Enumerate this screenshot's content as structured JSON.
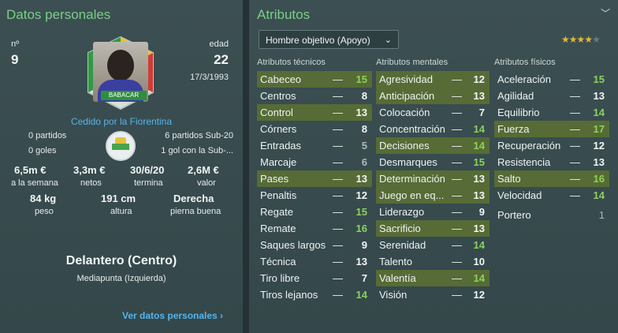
{
  "personal": {
    "title": "Datos personales",
    "number_label": "nº",
    "number": "9",
    "age_label": "edad",
    "age": "22",
    "dob": "17/3/1993",
    "badge_name": "BABACAR",
    "loan_text": "Cedido por la Fiorentina",
    "matches": "0 partidos",
    "goals": "0 goles",
    "sub20_matches": "6 partidos Sub-20",
    "sub20_goals": "1 gol con la Sub-...",
    "stats": [
      {
        "value": "6,5m €",
        "label": "a la semana"
      },
      {
        "value": "3,3m €",
        "label": "netos"
      },
      {
        "value": "30/6/20",
        "label": "termina"
      },
      {
        "value": "2,6M €",
        "label": "valor"
      }
    ],
    "body": [
      {
        "value": "84 kg",
        "label": "peso"
      },
      {
        "value": "191 cm",
        "label": "altura"
      },
      {
        "value": "Derecha",
        "label": "pierna buena"
      }
    ],
    "position": "Delantero (Centro)",
    "secondary_position": "Mediapunta (Izquierda)",
    "more_link": "Ver datos personales",
    "colors": {
      "accent_green": "#79cf86",
      "link_blue": "#54b4ee"
    }
  },
  "attributes": {
    "title": "Atributos",
    "role_select": "Hombre objetivo (Apoyo)",
    "rating_stars": 3.5,
    "tech_header": "Atributos técnicos",
    "mental_header": "Atributos mentales",
    "physical_header": "Atributos físicos",
    "technical": [
      {
        "name": "Cabeceo",
        "value": "15",
        "hl": true
      },
      {
        "name": "Centros",
        "value": "8",
        "hl": false
      },
      {
        "name": "Control",
        "value": "13",
        "hl": true
      },
      {
        "name": "Córners",
        "value": "8",
        "hl": false
      },
      {
        "name": "Entradas",
        "value": "5",
        "hl": false
      },
      {
        "name": "Marcaje",
        "value": "6",
        "hl": false
      },
      {
        "name": "Pases",
        "value": "13",
        "hl": true
      },
      {
        "name": "Penaltis",
        "value": "12",
        "hl": false
      },
      {
        "name": "Regate",
        "value": "15",
        "hl": false
      },
      {
        "name": "Remate",
        "value": "16",
        "hl": false
      },
      {
        "name": "Saques largos",
        "value": "9",
        "hl": false
      },
      {
        "name": "Técnica",
        "value": "13",
        "hl": false
      },
      {
        "name": "Tiro libre",
        "value": "7",
        "hl": false
      },
      {
        "name": "Tiros lejanos",
        "value": "14",
        "hl": false
      }
    ],
    "mental": [
      {
        "name": "Agresividad",
        "value": "12",
        "hl": true
      },
      {
        "name": "Anticipación",
        "value": "13",
        "hl": true
      },
      {
        "name": "Colocación",
        "value": "7",
        "hl": false
      },
      {
        "name": "Concentración",
        "value": "14",
        "hl": false
      },
      {
        "name": "Decisiones",
        "value": "14",
        "hl": true
      },
      {
        "name": "Desmarques",
        "value": "15",
        "hl": false
      },
      {
        "name": "Determinación",
        "value": "13",
        "hl": true
      },
      {
        "name": "Juego en eq...",
        "value": "13",
        "hl": true
      },
      {
        "name": "Liderazgo",
        "value": "9",
        "hl": false
      },
      {
        "name": "Sacrificio",
        "value": "13",
        "hl": true
      },
      {
        "name": "Serenidad",
        "value": "14",
        "hl": false
      },
      {
        "name": "Talento",
        "value": "10",
        "hl": false
      },
      {
        "name": "Valentía",
        "value": "14",
        "hl": true
      },
      {
        "name": "Visión",
        "value": "12",
        "hl": false
      }
    ],
    "physical": [
      {
        "name": "Aceleración",
        "value": "15",
        "hl": false
      },
      {
        "name": "Agilidad",
        "value": "13",
        "hl": false
      },
      {
        "name": "Equilibrio",
        "value": "14",
        "hl": false
      },
      {
        "name": "Fuerza",
        "value": "17",
        "hl": true
      },
      {
        "name": "Recuperación",
        "value": "12",
        "hl": false
      },
      {
        "name": "Resistencia",
        "value": "13",
        "hl": false
      },
      {
        "name": "Salto",
        "value": "16",
        "hl": true
      },
      {
        "name": "Velocidad",
        "value": "14",
        "hl": false
      }
    ],
    "goalkeeper": {
      "name": "Portero",
      "value": "1"
    }
  }
}
